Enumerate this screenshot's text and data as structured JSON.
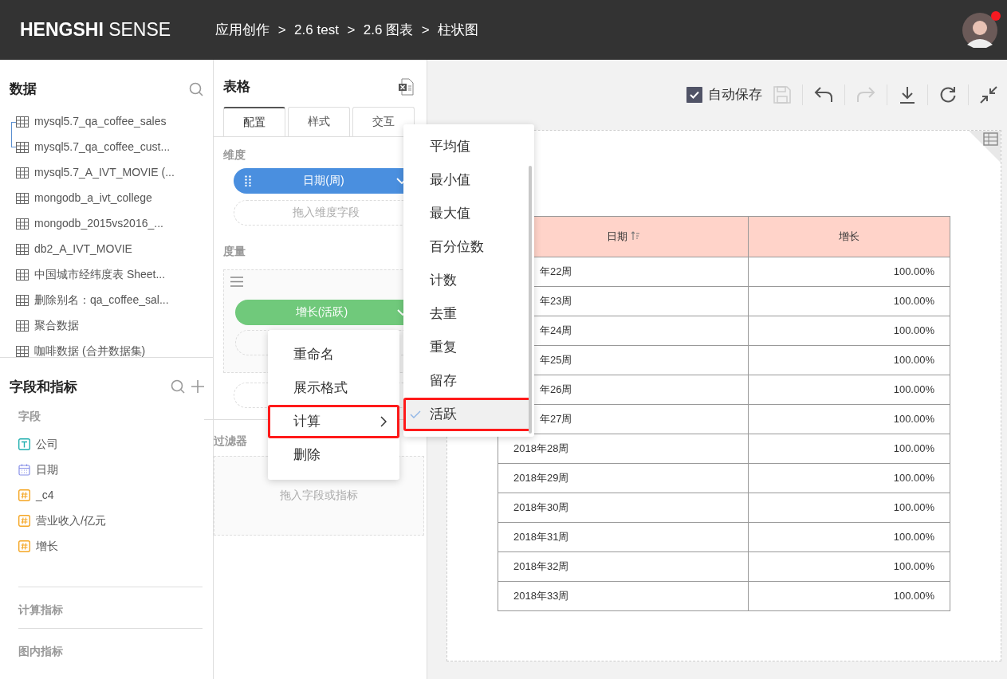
{
  "header": {
    "brand_bold": "HENGSHI",
    "brand_rest": "SENSE",
    "breadcrumb": [
      "应用创作",
      "2.6 test",
      "2.6 图表",
      "柱状图"
    ],
    "breadcrumb_separator": ">",
    "avatar": {
      "notification": true
    }
  },
  "data_panel": {
    "title": "数据",
    "datasets": [
      {
        "label": "mysql5.7_qa_coffee_sales",
        "linked": true
      },
      {
        "label": "mysql5.7_qa_coffee_cust...",
        "linked": true
      },
      {
        "label": "mysql5.7_A_IVT_MOVIE (...",
        "linked": false
      },
      {
        "label": "mongodb_a_ivt_college",
        "linked": false
      },
      {
        "label": "mongodb_2015vs2016_...",
        "linked": false
      },
      {
        "label": "db2_A_IVT_MOVIE",
        "linked": false
      },
      {
        "label": "中国城市经纬度表 Sheet...",
        "linked": false
      },
      {
        "label": "删除别名：qa_coffee_sal...",
        "linked": false
      },
      {
        "label": "聚合数据",
        "linked": false
      },
      {
        "label": "咖啡数据 (合并数据集)",
        "linked": false
      }
    ]
  },
  "fields_panel": {
    "title": "字段和指标",
    "fields_label": "字段",
    "fields": [
      {
        "label": "公司",
        "kind": "text"
      },
      {
        "label": "日期",
        "kind": "date"
      },
      {
        "label": "_c4",
        "kind": "number"
      },
      {
        "label": "营业收入/亿元",
        "kind": "number"
      },
      {
        "label": "增长",
        "kind": "number"
      }
    ],
    "sections": [
      "计算指标",
      "图内指标"
    ]
  },
  "config_panel": {
    "title": "表格",
    "tabs": [
      {
        "label": "配置",
        "selected": true
      },
      {
        "label": "样式",
        "selected": false
      },
      {
        "label": "交互",
        "selected": false
      }
    ],
    "dimension_label": "维度",
    "dimension_pill": "日期(周)",
    "dimension_placeholder": "拖入维度字段",
    "measure_label": "度量",
    "measure_pill": "增长(活跃)",
    "filter_label": "过滤器",
    "filter_placeholder": "拖入字段或指标"
  },
  "toolbar": {
    "autosave": {
      "label": "自动保存",
      "checked": true
    },
    "save_disabled": true,
    "redo_disabled": true
  },
  "table": {
    "columns": [
      {
        "label": "日期",
        "sortable": true
      },
      {
        "label": "增长",
        "sortable": false
      }
    ],
    "rows": [
      {
        "cells": [
          "年22周",
          "100.00%"
        ],
        "covered": true
      },
      {
        "cells": [
          "年23周",
          "100.00%"
        ],
        "covered": true
      },
      {
        "cells": [
          "年24周",
          "100.00%"
        ],
        "covered": true
      },
      {
        "cells": [
          "年25周",
          "100.00%"
        ],
        "covered": true
      },
      {
        "cells": [
          "年26周",
          "100.00%"
        ],
        "covered": true
      },
      {
        "cells": [
          "年27周",
          "100.00%"
        ],
        "covered": true
      },
      {
        "cells": [
          "2018年28周",
          "100.00%"
        ],
        "covered": false
      },
      {
        "cells": [
          "2018年29周",
          "100.00%"
        ],
        "covered": false
      },
      {
        "cells": [
          "2018年30周",
          "100.00%"
        ],
        "covered": false
      },
      {
        "cells": [
          "2018年31周",
          "100.00%"
        ],
        "covered": false
      },
      {
        "cells": [
          "2018年32周",
          "100.00%"
        ],
        "covered": false
      },
      {
        "cells": [
          "2018年33周",
          "100.00%"
        ],
        "covered": false
      }
    ]
  },
  "context_menu": {
    "items": [
      {
        "label": "重命名",
        "submenu": false,
        "annotated": false
      },
      {
        "label": "展示格式",
        "submenu": false,
        "annotated": false
      },
      {
        "label": "计算",
        "submenu": true,
        "annotated": true
      },
      {
        "label": "删除",
        "submenu": false,
        "annotated": false
      }
    ]
  },
  "calc_submenu": {
    "items": [
      {
        "label": "平均值",
        "selected": false,
        "annotated": false
      },
      {
        "label": "最小值",
        "selected": false,
        "annotated": false
      },
      {
        "label": "最大值",
        "selected": false,
        "annotated": false
      },
      {
        "label": "百分位数",
        "selected": false,
        "annotated": false
      },
      {
        "label": "计数",
        "selected": false,
        "annotated": false
      },
      {
        "label": "去重",
        "selected": false,
        "annotated": false
      },
      {
        "label": "重复",
        "selected": false,
        "annotated": false
      },
      {
        "label": "留存",
        "selected": false,
        "annotated": false
      },
      {
        "label": "活跃",
        "selected": true,
        "annotated": true
      }
    ]
  }
}
